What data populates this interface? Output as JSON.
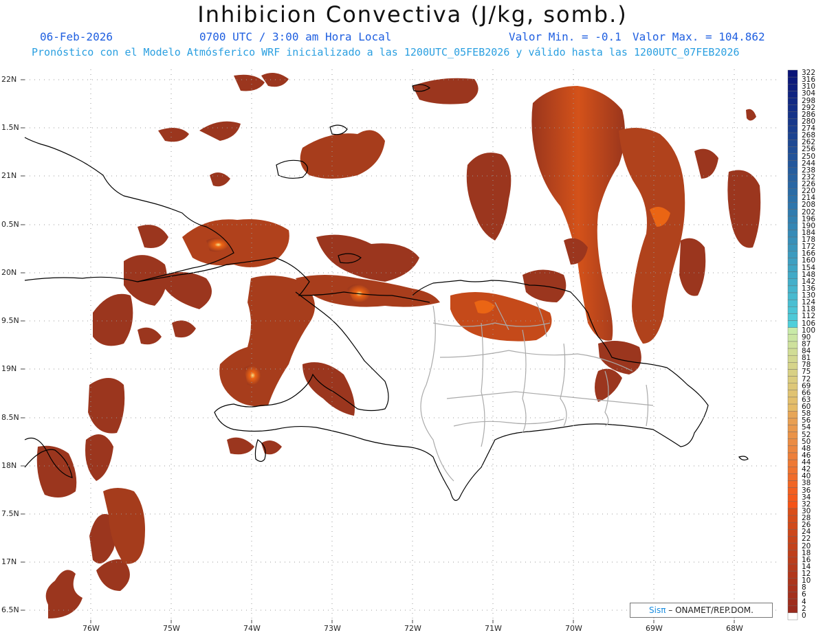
{
  "header": {
    "title": "Inhibicion Convectiva (J/kg, somb.)",
    "date": "06-Feb-2026",
    "time": "0700 UTC / 3:00 am Hora Local",
    "vmin": "Valor Min. = -0.1",
    "vmax": "Valor Max. = 104.862",
    "subtitle": "Pronóstico con el Modelo Atmósferico WRF inicializado a las 1200UTC_05FEB2026 y válido hasta las  1200UTC_07FEB2026"
  },
  "axes": {
    "lat_labels": [
      "22N",
      "1.5N",
      "21N",
      "0.5N",
      "20N",
      "9.5N",
      "19N",
      "8.5N",
      "18N",
      "7.5N",
      "17N",
      "6.5N"
    ],
    "lon_labels": [
      "76W",
      "75W",
      "74W",
      "73W",
      "72W",
      "71W",
      "70W",
      "69W",
      "68W"
    ]
  },
  "credit": {
    "sis": "Sisπ",
    "rest": " – ONAMET/REP.DOM."
  },
  "colorbar": {
    "labels": [
      "322",
      "316",
      "310",
      "304",
      "298",
      "292",
      "286",
      "280",
      "274",
      "268",
      "262",
      "256",
      "250",
      "244",
      "238",
      "232",
      "226",
      "220",
      "214",
      "208",
      "202",
      "196",
      "190",
      "184",
      "178",
      "172",
      "166",
      "160",
      "154",
      "148",
      "142",
      "136",
      "130",
      "124",
      "118",
      "112",
      "106",
      "100",
      "90",
      "87",
      "84",
      "81",
      "78",
      "75",
      "72",
      "69",
      "66",
      "63",
      "60",
      "58",
      "56",
      "54",
      "52",
      "50",
      "48",
      "46",
      "44",
      "42",
      "40",
      "38",
      "36",
      "34",
      "32",
      "30",
      "28",
      "26",
      "24",
      "22",
      "20",
      "18",
      "16",
      "14",
      "12",
      "10",
      "8",
      "6",
      "4",
      "2",
      "0"
    ]
  },
  "colors": {
    "field_dark": "#8e2f1f",
    "field_mid": "#b5431c",
    "field_hot": "#e85a12",
    "field_peak": "#f3e08a",
    "coast": "#000000",
    "provinces": "#aaaaaa"
  }
}
